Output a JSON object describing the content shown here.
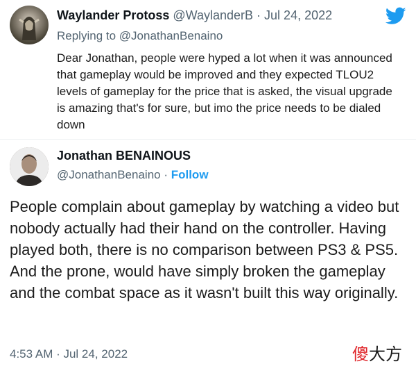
{
  "reply_tweet": {
    "display_name": "Waylander Protoss",
    "handle_date": "@WaylanderB · Jul 24, 2022",
    "replying_to": "Replying to @JonathanBenaino",
    "text": "Dear Jonathan, people were hyped a lot when it was announced that gameplay would be improved and they expected TLOU2 levels of gameplay for the price that is asked, the visual upgrade is amazing that's for sure, but imo the price needs to be dialed down"
  },
  "main_tweet": {
    "display_name": "Jonathan BENAINOUS",
    "handle": "@JonathanBenaino",
    "separator": " · ",
    "follow_label": "Follow",
    "text": "People complain about gameplay by watching a video but nobody actually had their hand on the controller. Having played both, there is no comparison between PS3 & PS5.\nAnd the prone, would have simply broken the gameplay and the combat space as it wasn't built this way originally.",
    "timestamp": "4:53 AM · Jul 24, 2022"
  },
  "icons": {
    "brand": "twitter-bird-icon",
    "brand_color": "#1d9bf0"
  },
  "watermark": {
    "part1": "傻",
    "part2": "大方"
  }
}
